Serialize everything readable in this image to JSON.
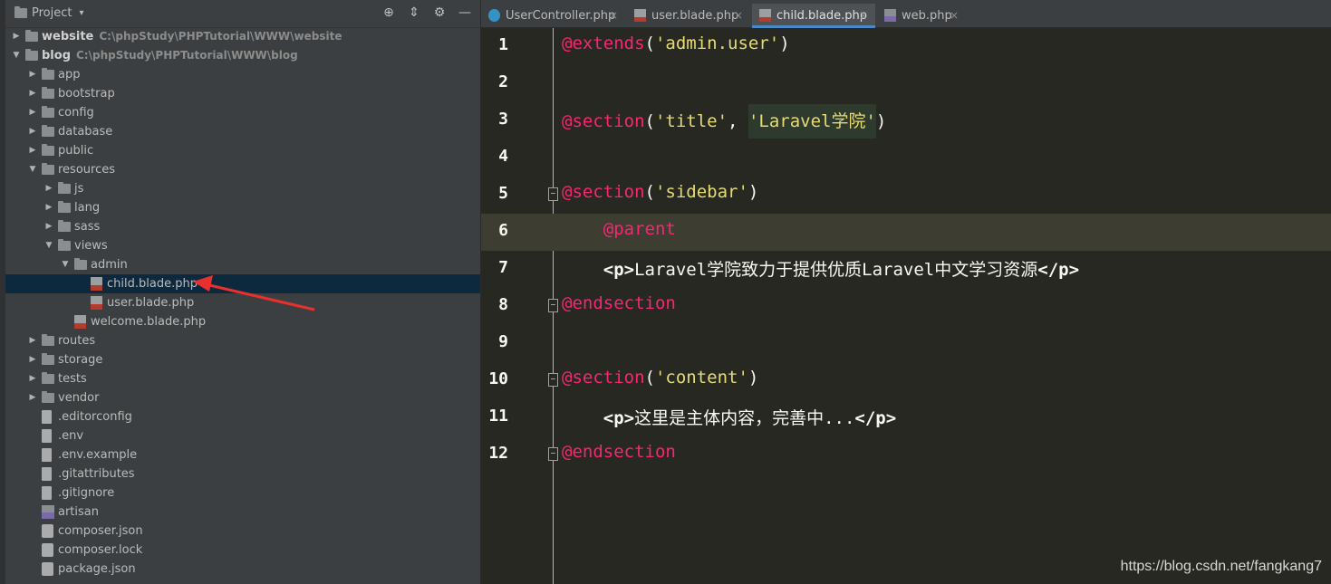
{
  "project_panel": {
    "title": "Project",
    "title_arrow": "▾",
    "tools": [
      "⊕",
      "⇕",
      "⚙",
      "—"
    ]
  },
  "tree": [
    {
      "label": "website",
      "path": "C:\\phpStudy\\PHPTutorial\\WWW\\website",
      "icon": "folder",
      "expand": "▶",
      "bold": true
    },
    {
      "label": "blog",
      "path": "C:\\phpStudy\\PHPTutorial\\WWW\\blog",
      "icon": "folder",
      "expand": "▼",
      "bold": true
    },
    {
      "label": "app",
      "icon": "folder",
      "expand": "▶"
    },
    {
      "label": "bootstrap",
      "icon": "folder",
      "expand": "▶"
    },
    {
      "label": "config",
      "icon": "folder",
      "expand": "▶"
    },
    {
      "label": "database",
      "icon": "folder",
      "expand": "▶"
    },
    {
      "label": "public",
      "icon": "folder",
      "expand": "▶"
    },
    {
      "label": "resources",
      "icon": "folder",
      "expand": "▼"
    },
    {
      "label": "js",
      "icon": "folder",
      "expand": "▶"
    },
    {
      "label": "lang",
      "icon": "folder",
      "expand": "▶"
    },
    {
      "label": "sass",
      "icon": "folder",
      "expand": "▶"
    },
    {
      "label": "views",
      "icon": "folder",
      "expand": "▼"
    },
    {
      "label": "admin",
      "icon": "folder",
      "expand": "▼"
    },
    {
      "label": "child.blade.php",
      "icon": "blade",
      "selected": true
    },
    {
      "label": "user.blade.php",
      "icon": "blade"
    },
    {
      "label": "welcome.blade.php",
      "icon": "blade"
    },
    {
      "label": "routes",
      "icon": "folder",
      "expand": "▶"
    },
    {
      "label": "storage",
      "icon": "folder",
      "expand": "▶"
    },
    {
      "label": "tests",
      "icon": "folder",
      "expand": "▶"
    },
    {
      "label": "vendor",
      "icon": "folder",
      "expand": "▶"
    },
    {
      "label": ".editorconfig",
      "icon": "file"
    },
    {
      "label": ".env",
      "icon": "file"
    },
    {
      "label": ".env.example",
      "icon": "file"
    },
    {
      "label": ".gitattributes",
      "icon": "file"
    },
    {
      "label": ".gitignore",
      "icon": "file"
    },
    {
      "label": "artisan",
      "icon": "php"
    },
    {
      "label": "composer.json",
      "icon": "json"
    },
    {
      "label": "composer.lock",
      "icon": "json"
    },
    {
      "label": "package.json",
      "icon": "json"
    }
  ],
  "tabs": [
    {
      "label": "UserController.php",
      "icon": "class",
      "close": "×"
    },
    {
      "label": "user.blade.php",
      "icon": "blade",
      "close": "×"
    },
    {
      "label": "child.blade.php",
      "icon": "blade",
      "close": "×",
      "active": true
    },
    {
      "label": "web.php",
      "icon": "php",
      "close": "×"
    }
  ],
  "code_lines": [
    {
      "num": "1",
      "tokens": [
        [
          "kw",
          "@extends"
        ],
        [
          "punc",
          "("
        ],
        [
          "str",
          "'admin.user'"
        ],
        [
          "punc",
          ")"
        ]
      ]
    },
    {
      "num": "2",
      "tokens": []
    },
    {
      "num": "3",
      "tokens": [
        [
          "kw",
          "@section"
        ],
        [
          "punc",
          "("
        ],
        [
          "str",
          "'title'"
        ],
        [
          "punc",
          ", "
        ],
        [
          "str",
          "'Laravel学院'"
        ],
        [
          "punc",
          ")"
        ]
      ]
    },
    {
      "num": "4",
      "tokens": []
    },
    {
      "num": "5",
      "fold": true,
      "tokens": [
        [
          "kw",
          "@section"
        ],
        [
          "punc",
          "("
        ],
        [
          "str",
          "'sidebar'"
        ],
        [
          "punc",
          ")"
        ]
      ]
    },
    {
      "num": "6",
      "current": true,
      "tokens": [
        [
          "txt",
          "    "
        ],
        [
          "kw",
          "@parent"
        ]
      ]
    },
    {
      "num": "7",
      "tokens": [
        [
          "txt",
          "    "
        ],
        [
          "tag",
          "<p>"
        ],
        [
          "txt",
          "Laravel学院致力于提供优质Laravel中文学习资源"
        ],
        [
          "tag",
          "</p>"
        ]
      ]
    },
    {
      "num": "8",
      "fold": true,
      "tokens": [
        [
          "kw",
          "@endsection"
        ]
      ]
    },
    {
      "num": "9",
      "tokens": []
    },
    {
      "num": "10",
      "fold": true,
      "tokens": [
        [
          "kw",
          "@section"
        ],
        [
          "punc",
          "("
        ],
        [
          "str",
          "'content'"
        ],
        [
          "punc",
          ")"
        ]
      ]
    },
    {
      "num": "11",
      "tokens": [
        [
          "txt",
          "    "
        ],
        [
          "tag",
          "<p>"
        ],
        [
          "txt",
          "这里是主体内容，完善中..."
        ],
        [
          "tag",
          "</p>"
        ]
      ]
    },
    {
      "num": "12",
      "fold": true,
      "tokens": [
        [
          "kw",
          "@endsection"
        ]
      ]
    }
  ],
  "watermark": "https://blog.csdn.net/fangkang7",
  "colors": {
    "keyword": "#f92672",
    "string": "#e6db74",
    "text": "#f8f8f2",
    "selection": "#0d293e",
    "arrow": "#e8312f"
  }
}
